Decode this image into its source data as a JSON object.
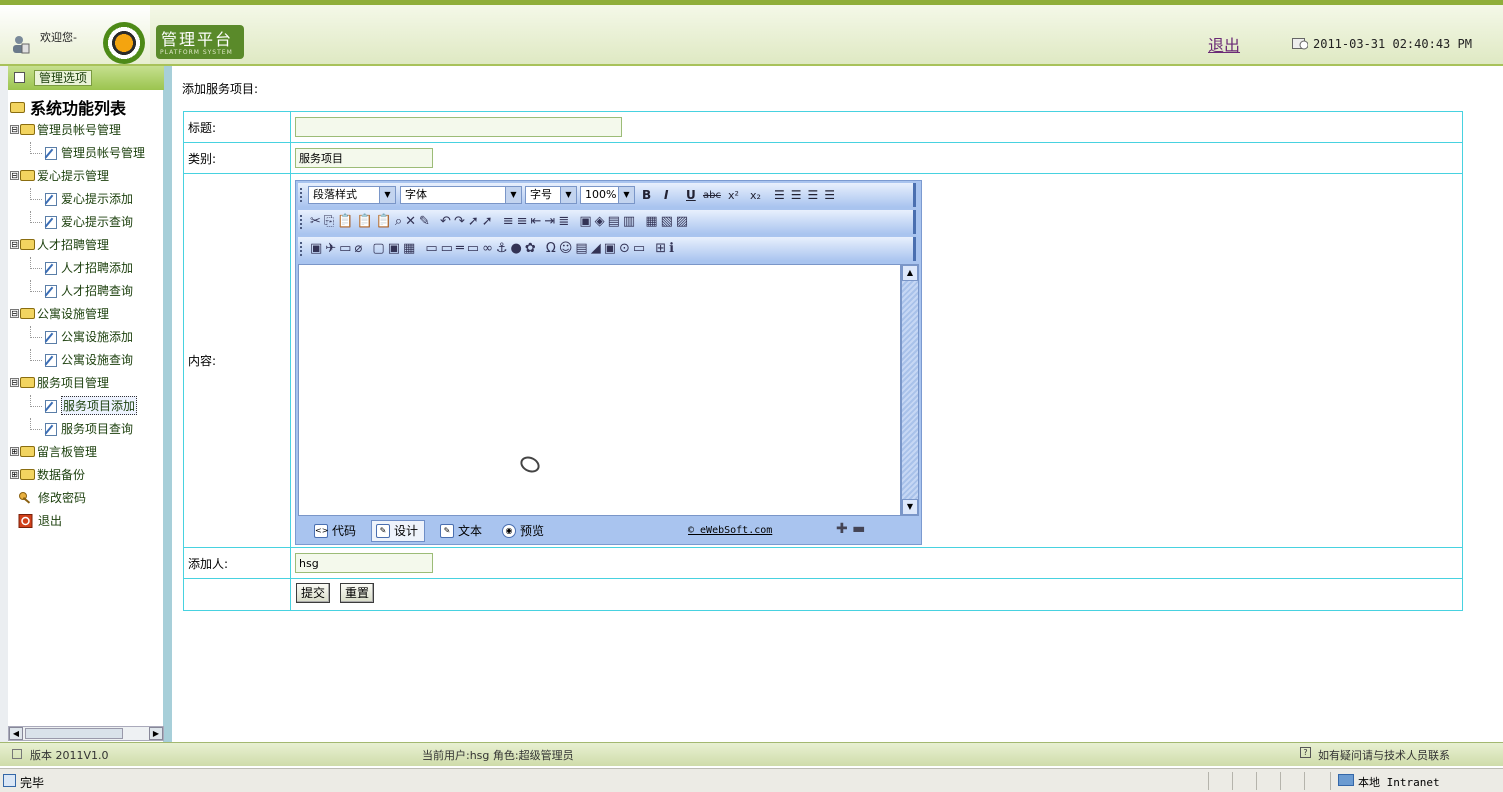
{
  "header": {
    "welcome": "欢迎您-",
    "logo_title": "管理平台",
    "logo_subtitle": "PLATFORM SYSTEM",
    "logout": "退出",
    "datetime": "2011-03-31 02:40:43 PM"
  },
  "sidebar": {
    "tab_label": "管理选项",
    "root": "系统功能列表",
    "groups": [
      {
        "label": "管理员帐号管理",
        "toggle": "⊟",
        "children": [
          "管理员帐号管理"
        ]
      },
      {
        "label": "爱心提示管理",
        "toggle": "⊟",
        "children": [
          "爱心提示添加",
          "爱心提示查询"
        ]
      },
      {
        "label": "人才招聘管理",
        "toggle": "⊟",
        "children": [
          "人才招聘添加",
          "人才招聘查询"
        ]
      },
      {
        "label": "公寓设施管理",
        "toggle": "⊟",
        "children": [
          "公寓设施添加",
          "公寓设施查询"
        ]
      },
      {
        "label": "服务项目管理",
        "toggle": "⊟",
        "children": [
          "服务项目添加",
          "服务项目查询"
        ]
      },
      {
        "label": "留言板管理",
        "toggle": "⊞",
        "children": []
      },
      {
        "label": "数据备份",
        "toggle": "⊞",
        "children": []
      }
    ],
    "change_password": "修改密码",
    "exit": "退出",
    "selected": "服务项目添加"
  },
  "form": {
    "heading": "添加服务项目:",
    "title_label": "标题:",
    "title_value": "",
    "category_label": "类别:",
    "category_value": "服务项目",
    "content_label": "内容:",
    "author_label": "添加人:",
    "author_value": "hsg",
    "submit": "提交",
    "reset": "重置"
  },
  "editor": {
    "paragraph_style": "段落样式",
    "font": "字体",
    "font_size": "字号",
    "zoom": "100%",
    "bold": "B",
    "italic": "I",
    "underline": "U",
    "strike": "abc",
    "superscript": "x²",
    "subscript": "x₂",
    "tabs": [
      "代码",
      "设计",
      "文本",
      "预览"
    ],
    "active_tab": "设计",
    "credit": "© eWebSoft.com",
    "zoom_controls": "✚ ▬"
  },
  "footer": {
    "version": "版本 2011V1.0",
    "current_user": "当前用户:hsg  角色:超级管理员",
    "help": "如有疑问请与技术人员联系"
  },
  "statusbar": {
    "status": "完毕",
    "zone": "本地 Intranet"
  },
  "colors": {
    "header_green": "#8fae3a",
    "table_border": "#48d2e0",
    "editor_blue": "#a9c4ef"
  }
}
